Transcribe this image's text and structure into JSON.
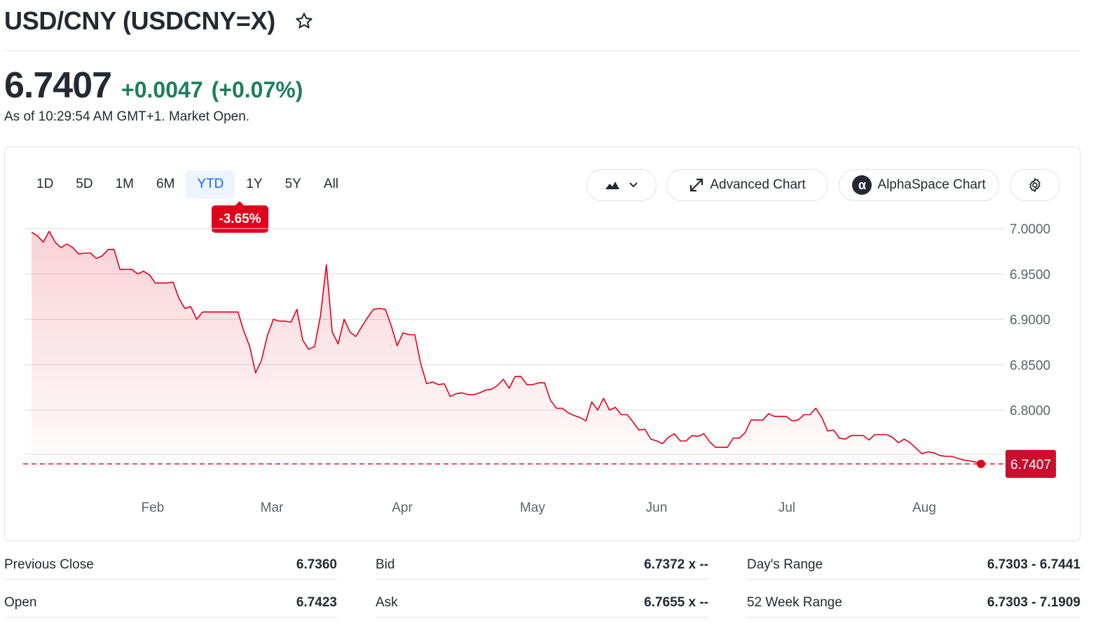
{
  "header": {
    "title": "USD/CNY (USDCNY=X)",
    "price": "6.7407",
    "change": "+0.0047",
    "change_pct": "(+0.07%)",
    "as_of": "As of 10:29:54 AM GMT+1. Market Open."
  },
  "range_tabs": [
    "1D",
    "5D",
    "1M",
    "6M",
    "YTD",
    "1Y",
    "5Y",
    "All"
  ],
  "active_range": "YTD",
  "range_change_badge": "-3.65%",
  "toolbar": {
    "advanced_chart": "Advanced Chart",
    "alphaspace_chart": "AlphaSpace Chart",
    "alpha_logo": "α"
  },
  "icons": {
    "favorite": "star-outline-icon",
    "chart_type": "mountain-chart-icon",
    "dropdown": "chevron-down-icon",
    "expand": "expand-arrows-icon",
    "settings": "gear-icon"
  },
  "colors": {
    "line": "#e0001b",
    "positive": "#1d7e5a",
    "active_tab": "#0f69ff",
    "badge": "#e0001b",
    "price_tag": "#c8102e"
  },
  "chart_data": {
    "type": "area",
    "x_axis_labels": [
      "Feb",
      "Mar",
      "Apr",
      "May",
      "Jun",
      "Jul",
      "Aug"
    ],
    "y_tick_labels": [
      "7.0000",
      "6.9500",
      "6.9000",
      "6.8500",
      "6.8000"
    ],
    "ylim": [
      6.74,
      7.0
    ],
    "grid": true,
    "last_price_label": "6.7407",
    "last_price": 6.7407,
    "values": [
      6.996,
      6.992,
      6.985,
      6.997,
      6.985,
      6.979,
      6.983,
      6.979,
      6.972,
      6.973,
      6.973,
      6.967,
      6.97,
      6.977,
      6.977,
      6.955,
      6.955,
      6.955,
      6.95,
      6.953,
      6.949,
      6.94,
      6.94,
      6.94,
      6.941,
      6.923,
      6.912,
      6.914,
      6.9,
      6.908,
      6.908,
      6.908,
      6.908,
      6.908,
      6.908,
      6.908,
      6.887,
      6.87,
      6.841,
      6.855,
      6.882,
      6.9,
      6.898,
      6.898,
      6.897,
      6.911,
      6.877,
      6.867,
      6.87,
      6.904,
      6.96,
      6.886,
      6.873,
      6.9,
      6.886,
      6.881,
      6.892,
      6.902,
      6.911,
      6.912,
      6.911,
      6.893,
      6.871,
      6.885,
      6.883,
      6.883,
      6.851,
      6.829,
      6.831,
      6.828,
      6.829,
      6.815,
      6.818,
      6.819,
      6.817,
      6.817,
      6.819,
      6.822,
      6.823,
      6.827,
      6.834,
      6.824,
      6.837,
      6.837,
      6.828,
      6.828,
      6.83,
      6.83,
      6.811,
      6.802,
      6.802,
      6.797,
      6.794,
      6.792,
      6.788,
      6.809,
      6.8,
      6.813,
      6.8,
      6.803,
      6.795,
      6.795,
      6.787,
      6.778,
      6.779,
      6.768,
      6.766,
      6.763,
      6.77,
      6.774,
      6.766,
      6.766,
      6.772,
      6.771,
      6.774,
      6.765,
      6.759,
      6.759,
      6.759,
      6.769,
      6.769,
      6.775,
      6.789,
      6.789,
      6.789,
      6.796,
      6.793,
      6.793,
      6.793,
      6.788,
      6.789,
      6.795,
      6.795,
      6.802,
      6.792,
      6.777,
      6.778,
      6.769,
      6.768,
      6.772,
      6.772,
      6.772,
      6.767,
      6.773,
      6.773,
      6.773,
      6.77,
      6.764,
      6.768,
      6.764,
      6.758,
      6.752,
      6.754,
      6.753,
      6.75,
      6.749,
      6.749,
      6.747,
      6.745,
      6.744,
      6.743,
      6.741
    ]
  },
  "stats": {
    "col1": [
      {
        "label": "Previous Close",
        "value": "6.7360"
      },
      {
        "label": "Open",
        "value": "6.7423"
      }
    ],
    "col2": [
      {
        "label": "Bid",
        "value": "6.7372 x --"
      },
      {
        "label": "Ask",
        "value": "6.7655 x --"
      }
    ],
    "col3": [
      {
        "label": "Day's Range",
        "value": "6.7303 - 6.7441"
      },
      {
        "label": "52 Week Range",
        "value": "6.7303 - 7.1909"
      }
    ]
  }
}
